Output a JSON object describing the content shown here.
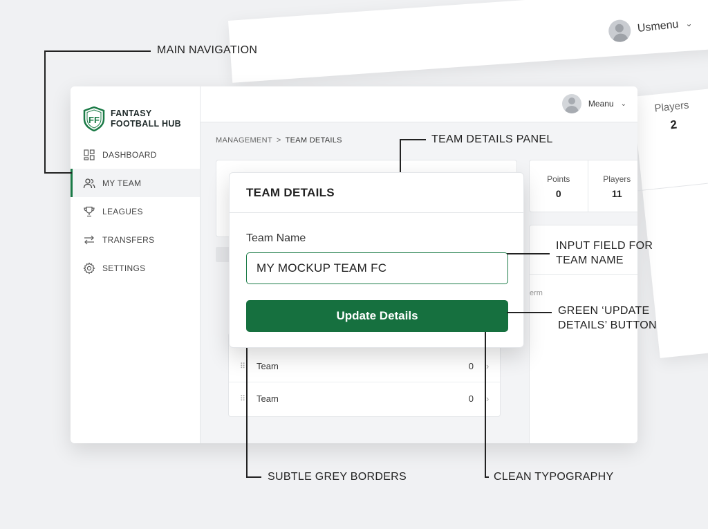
{
  "background": {
    "user_name": "Usmenu",
    "players_label": "Players",
    "players_value": "2"
  },
  "brand": {
    "line1": "FANTASY",
    "line2": "FOOTBALL HUB",
    "accent_color": "#1a7a46"
  },
  "sidebar": {
    "items": [
      {
        "label": "DASHBOARD",
        "icon": "grid-icon",
        "active": false
      },
      {
        "label": "MY TEAM",
        "icon": "users-icon",
        "active": true
      },
      {
        "label": "LEAGUES",
        "icon": "trophy-icon",
        "active": false
      },
      {
        "label": "TRANSFERS",
        "icon": "swap-arrows-icon",
        "active": false
      },
      {
        "label": "SETTINGS",
        "icon": "gear-icon",
        "active": false
      }
    ]
  },
  "header": {
    "user_name": "Meanu"
  },
  "breadcrumb": {
    "parent": "MANAGEMENT",
    "separator": ">",
    "current": "TEAM DETAILS"
  },
  "stats": [
    {
      "label": "Points",
      "value": "0"
    },
    {
      "label": "Players",
      "value": "11"
    }
  ],
  "right_card": {
    "partial_text": "erm"
  },
  "team_list": [
    {
      "name": "Team",
      "value": "0"
    },
    {
      "name": "Team",
      "value": "0"
    }
  ],
  "modal": {
    "title": "TEAM DETAILS",
    "field_label": "Team Name",
    "field_value": "MY MOCKUP TEAM FC",
    "button_label": "Update Details",
    "button_color": "#16703f"
  },
  "annotations": {
    "main_navigation": "MAIN NAVIGATION",
    "team_details_panel": "TEAM DETAILS PANEL",
    "input_field_line1": "INPUT FIELD FOR",
    "input_field_line2": "TEAM NAME",
    "button_line1": "GREEN ‘UPDATE",
    "button_line2": "DETAILS’ BUTTON",
    "grey_borders": "SUBTLE GREY BORDERS",
    "typography": "CLEAN TYPOGRAPHY"
  }
}
